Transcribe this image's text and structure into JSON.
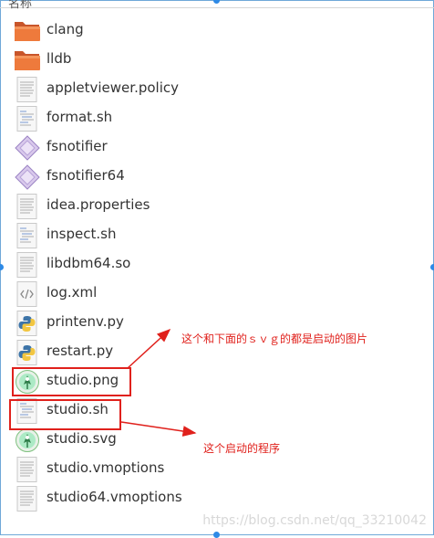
{
  "header": {
    "column_label": "名称"
  },
  "files": [
    {
      "name": "clang",
      "icon": "folder-icon"
    },
    {
      "name": "lldb",
      "icon": "folder-icon"
    },
    {
      "name": "appletviewer.policy",
      "icon": "text-file-icon"
    },
    {
      "name": "format.sh",
      "icon": "script-file-icon"
    },
    {
      "name": "fsnotifier",
      "icon": "executable-icon"
    },
    {
      "name": "fsnotifier64",
      "icon": "executable-icon"
    },
    {
      "name": "idea.properties",
      "icon": "text-file-icon"
    },
    {
      "name": "inspect.sh",
      "icon": "script-file-icon"
    },
    {
      "name": "libdbm64.so",
      "icon": "text-file-icon"
    },
    {
      "name": "log.xml",
      "icon": "xml-file-icon"
    },
    {
      "name": "printenv.py",
      "icon": "python-file-icon"
    },
    {
      "name": "restart.py",
      "icon": "python-file-icon"
    },
    {
      "name": "studio.png",
      "icon": "android-studio-icon"
    },
    {
      "name": "studio.sh",
      "icon": "script-file-icon"
    },
    {
      "name": "studio.svg",
      "icon": "android-studio-icon"
    },
    {
      "name": "studio.vmoptions",
      "icon": "text-file-icon"
    },
    {
      "name": "studio64.vmoptions",
      "icon": "text-file-icon"
    }
  ],
  "annotations": {
    "note_images": "这个和下面的ｓｖｇ的都是启动的图片",
    "note_program": "这个启动的程序"
  },
  "colors": {
    "annotation": "#e0211c",
    "folder": "#e8743b",
    "selection_border": "#6fa8d8"
  },
  "watermark": "https://blog.csdn.net/qq_33210042"
}
